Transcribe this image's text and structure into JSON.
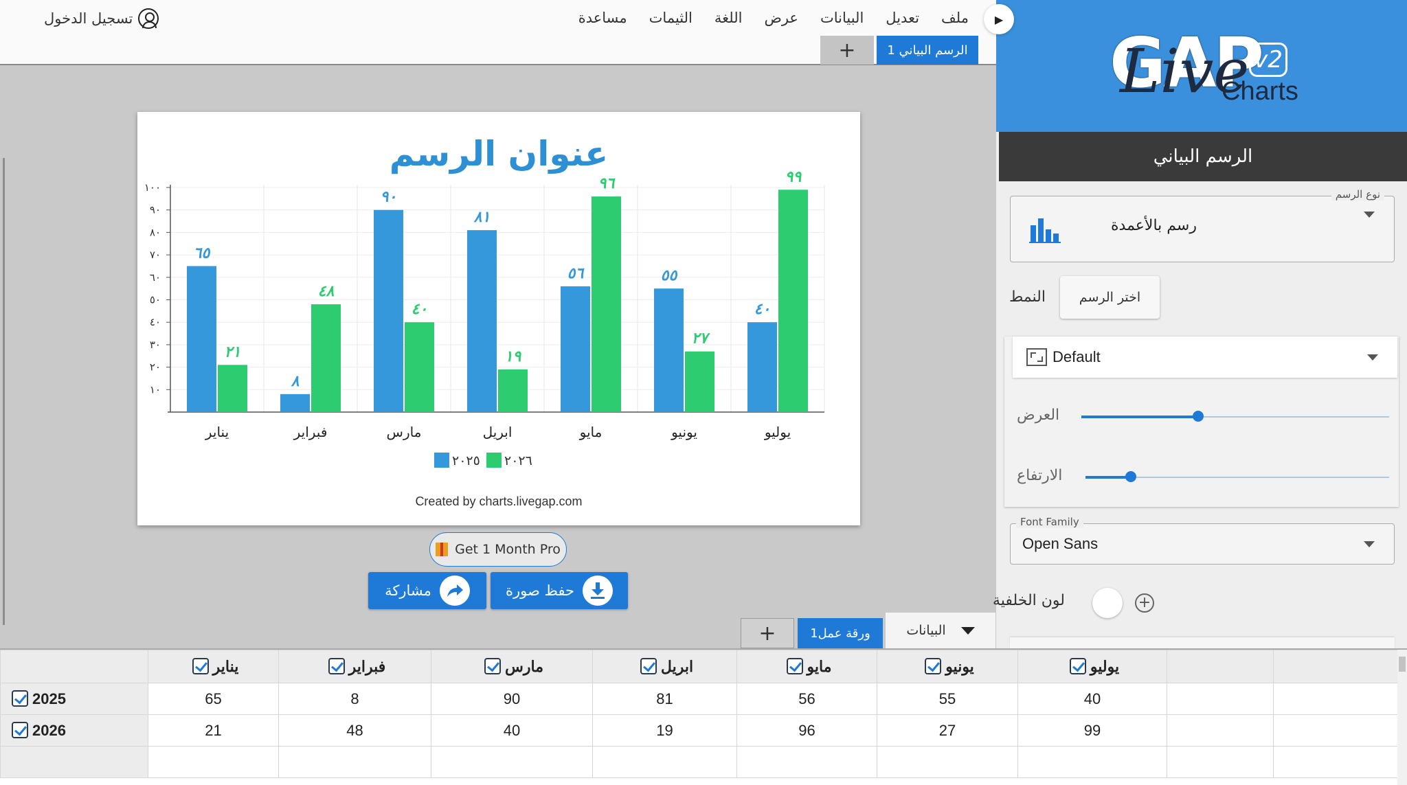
{
  "menu": {
    "items": [
      "ملف",
      "تعديل",
      "البيانات",
      "عرض",
      "اللغة",
      "الثيمات",
      "مساعدة"
    ],
    "login": "تسجيل الدخول"
  },
  "tabs": {
    "chart_tab": "الرسم البياني 1",
    "sheet_tab": "ورقة عمل1",
    "data_toggle": "البيانات"
  },
  "canvas": {
    "credit": "Created by charts.livegap.com",
    "pro_button": "Get 1 Month Pro",
    "share_button": "مشاركة",
    "save_button": "حفظ صورة"
  },
  "panel": {
    "logo_main": "GAP",
    "logo_script": "Live",
    "logo_sub": "Charts",
    "logo_version": "v2",
    "header": "الرسم البياني",
    "type_legend": "نوع الرسم",
    "type_value": "رسم بالأعمدة",
    "style_label": "النمط",
    "pick_chart": "اختر الرسم",
    "preset_value": "Default",
    "width_label": "العرض",
    "height_label": "الارتفاع",
    "width_level": 0.38,
    "height_level": 0.15,
    "font_legend": "Font Family",
    "font_value": "Open Sans",
    "bg_label": "لون الخلفية"
  },
  "grid": {
    "columns": [
      "يناير",
      "فبراير",
      "مارس",
      "ابريل",
      "مايو",
      "يونيو",
      "يوليو"
    ],
    "rows": [
      {
        "label": "2025",
        "values": [
          "65",
          "8",
          "90",
          "81",
          "56",
          "55",
          "40"
        ]
      },
      {
        "label": "2026",
        "values": [
          "21",
          "48",
          "40",
          "19",
          "96",
          "27",
          "99"
        ]
      }
    ]
  },
  "colors": {
    "accent": "#1e7ad6",
    "series_2025": "#3598db",
    "series_2026": "#2ecc71",
    "panel_top": "#3a90dc"
  },
  "chart_data": {
    "type": "bar",
    "title": "عنوان الرسم",
    "categories": [
      "يناير",
      "فبراير",
      "مارس",
      "ابريل",
      "مايو",
      "يونيو",
      "يوليو"
    ],
    "series": [
      {
        "name": "٢٠٢٥",
        "values": [
          65,
          8,
          90,
          81,
          56,
          55,
          40
        ],
        "color": "#3598db",
        "labels": [
          "٦٥",
          "٨",
          "٩٠",
          "٨١",
          "٥٦",
          "٥٥",
          "٤٠"
        ]
      },
      {
        "name": "٢٠٢٦",
        "values": [
          21,
          48,
          40,
          19,
          96,
          27,
          99
        ],
        "color": "#2ecc71",
        "labels": [
          "٢١",
          "٤٨",
          "٤٠",
          "١٩",
          "٩٦",
          "٢٧",
          "٩٩"
        ]
      }
    ],
    "yticks": [
      "١٠",
      "٢٠",
      "٣٠",
      "٤٠",
      "٥٠",
      "٦٠",
      "٧٠",
      "٨٠",
      "٩٠",
      "١٠٠"
    ],
    "ylim": [
      0,
      100
    ],
    "grid": true,
    "legend": "bottom-center"
  }
}
